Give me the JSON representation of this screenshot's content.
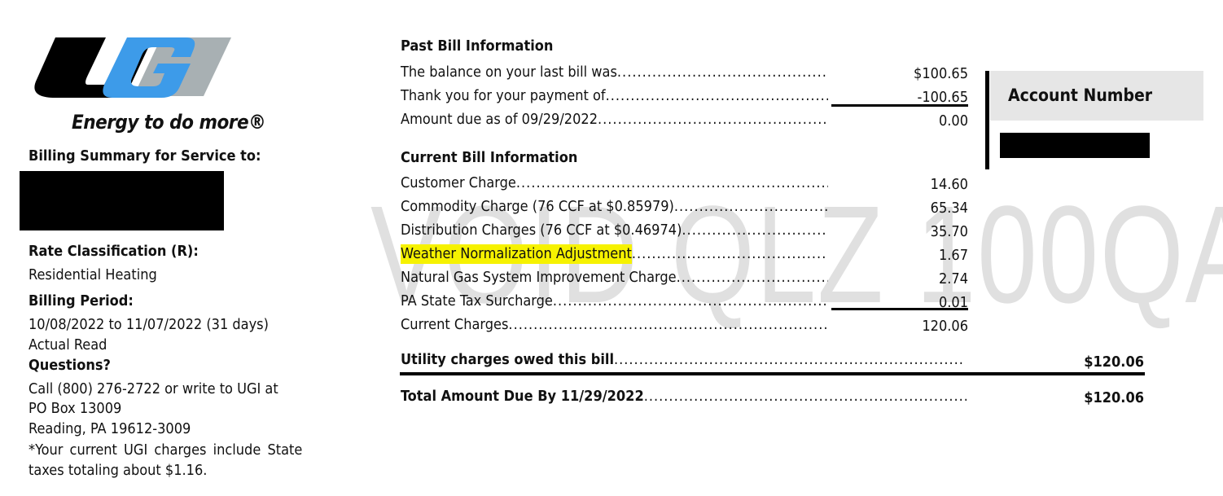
{
  "logo": {
    "text": "UGI",
    "tagline": "Energy to do more®",
    "colors": {
      "black": "#000000",
      "blue": "#3d9be9",
      "gray": "#a8b0b3"
    }
  },
  "watermark": "VOID QLZ 100QA",
  "left": {
    "billing_summary": "Billing Summary for Service to:",
    "rate_label": "Rate Classification (R):",
    "rate_value": "Residential Heating",
    "period_label": "Billing Period:",
    "period_value": "10/08/2022 to 11/07/2022 (31 days)",
    "read_type": "Actual Read",
    "questions_label": "Questions?",
    "contact_lines": [
      "Call (800) 276-2722 or write to UGI at",
      "PO Box 13009",
      "Reading, PA 19612-3009"
    ],
    "note_lines": [
      "*Your current UGI charges include State",
      "taxes totaling about  $1.16."
    ]
  },
  "past": {
    "title": "Past Bill Information",
    "rows": [
      {
        "label": "The balance on your last bill was",
        "amount": "$100.65"
      },
      {
        "label": "Thank you for your payment of",
        "amount": "-100.65"
      },
      {
        "label": "Amount due as of 09/29/2022",
        "amount": "0.00"
      }
    ]
  },
  "current": {
    "title": "Current Bill Information",
    "rows": [
      {
        "label": "Customer Charge",
        "amount": "14.60"
      },
      {
        "label": "Commodity Charge (76 CCF at $0.85979)",
        "amount": "65.34"
      },
      {
        "label": "Distribution Charges (76 CCF at $0.46974)",
        "amount": "35.70"
      },
      {
        "label": "Weather Normalization Adjustment",
        "amount": "1.67",
        "highlight": "#f6f200"
      },
      {
        "label": "Natural Gas System Improvement Charge",
        "amount": "2.74"
      },
      {
        "label": "PA State Tax Surcharge",
        "amount": "0.01"
      },
      {
        "label": "Current Charges",
        "amount": "120.06"
      }
    ]
  },
  "utility": {
    "label": "Utility charges owed this bill",
    "amount": "$120.06"
  },
  "total": {
    "label": "Total Amount Due By 11/29/2022",
    "amount": "$120.06"
  },
  "account": {
    "label": "Account Number"
  }
}
